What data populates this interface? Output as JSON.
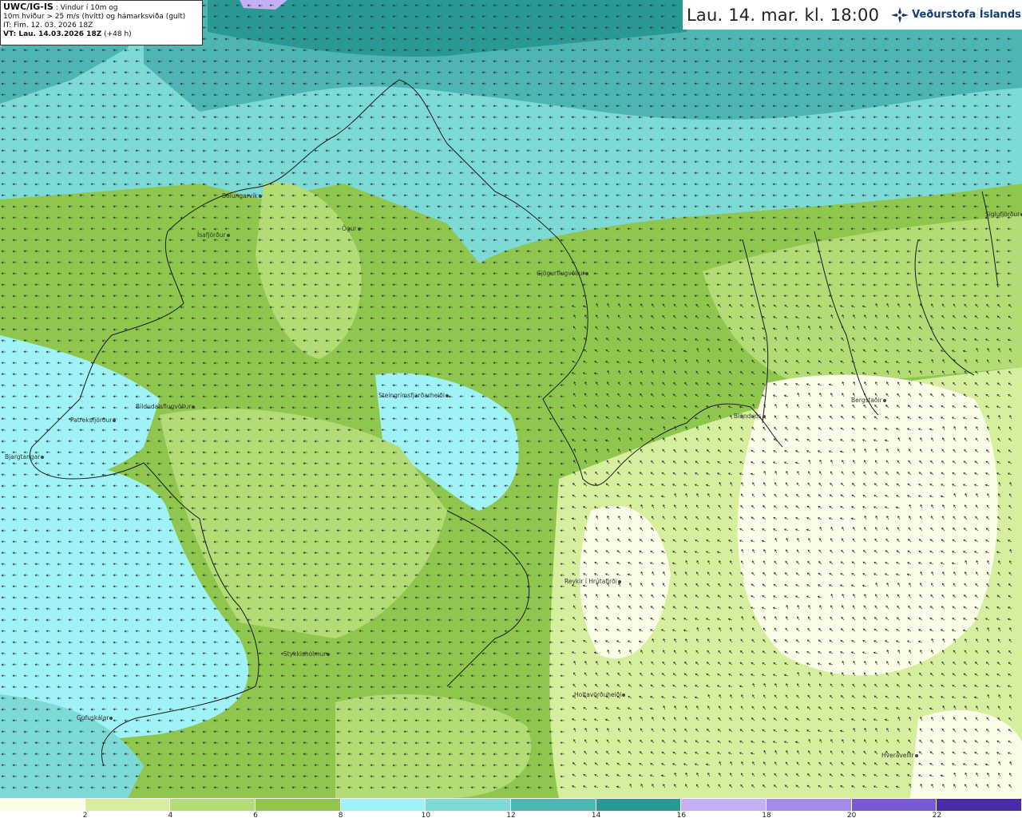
{
  "info": {
    "model": "UWC/IG-IS",
    "desc1": " : Vindur í 10m og",
    "desc2": "10m hviður > 25 m/s (hvítt) og hámarksviða (gult)",
    "it": "IT: Fim. 12. 03. 2026 18Z",
    "vt_label": "VT: Lau. 14.03.2026 18Z",
    "vt_offset": " (+48 h)"
  },
  "header": {
    "datetime": "Lau. 14. mar. kl. 18:00",
    "logo": "Veðurstofa Íslands"
  },
  "legend": {
    "colors": [
      "#fbfde8",
      "#d6ef9e",
      "#b3dc76",
      "#8fc74e",
      "#9ff3f6",
      "#7ddad4",
      "#4eb6b2",
      "#2a9994",
      "#c5b0f7",
      "#a58ae9",
      "#7a58d2",
      "#4a2aa5"
    ],
    "ticks": [
      "2",
      "4",
      "6",
      "8",
      "10",
      "12",
      "14",
      "16",
      "18",
      "20",
      "22"
    ]
  },
  "places": [
    {
      "name": "Bolungarvík"
    },
    {
      "name": "Ísafjörður"
    },
    {
      "name": "Ögur"
    },
    {
      "name": "Gjögurflugvöllur"
    },
    {
      "name": "Siglufjörður"
    },
    {
      "name": "Steingrímsfjarðarheiði"
    },
    {
      "name": "Bíldudalsflugvöllur"
    },
    {
      "name": "Patreksfjörður"
    },
    {
      "name": "Bjargtangar"
    },
    {
      "name": "Blönduós"
    },
    {
      "name": "Bergstaðir"
    },
    {
      "name": "Reykir í Hrútafirði"
    },
    {
      "name": "Stykkishólmur"
    },
    {
      "name": "Holtavörðuheiði"
    },
    {
      "name": "Gufuskálar"
    },
    {
      "name": "Hveravellir"
    }
  ]
}
